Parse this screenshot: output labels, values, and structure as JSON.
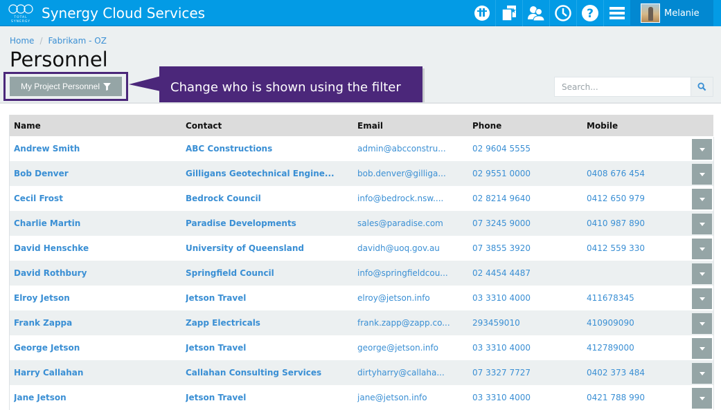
{
  "app": {
    "title": "Synergy Cloud Services",
    "logo_text": "TOTAL SYNERGY",
    "brand_color": "#039be5"
  },
  "nav": {
    "icons": [
      {
        "name": "dashboard-icon",
        "label": "Dashboard"
      },
      {
        "name": "projects-icon",
        "label": "Projects"
      },
      {
        "name": "contacts-icon",
        "label": "Contacts"
      },
      {
        "name": "timesheet-clock-icon",
        "label": "Timesheets"
      },
      {
        "name": "help-icon",
        "label": "Help"
      },
      {
        "name": "menu-icon",
        "label": "Menu"
      }
    ],
    "user": {
      "name": "Melanie"
    }
  },
  "breadcrumb": {
    "items": [
      "Home",
      "Fabrikam - OZ"
    ],
    "separator": "/"
  },
  "page": {
    "title": "Personnel"
  },
  "filter": {
    "label": "My Project Personnel",
    "icon": "filter-icon"
  },
  "callout": {
    "text": "Change who is shown using the filter",
    "color": "#4b277a"
  },
  "search": {
    "placeholder": "Search...",
    "value": ""
  },
  "table": {
    "columns": [
      "Name",
      "Contact",
      "Email",
      "Phone",
      "Mobile"
    ],
    "rows": [
      {
        "name": "Andrew Smith",
        "contact": "ABC Constructions",
        "email": "admin@abcconstru...",
        "phone": "02 9604 5555",
        "mobile": ""
      },
      {
        "name": "Bob Denver",
        "contact": "Gilligans Geotechnical Engine...",
        "email": "bob.denver@gilliga...",
        "phone": "02 9551 0000",
        "mobile": "0408 676 454"
      },
      {
        "name": "Cecil Frost",
        "contact": "Bedrock Council",
        "email": "info@bedrock.nsw....",
        "phone": "02 8214 9640",
        "mobile": "0412 650 979"
      },
      {
        "name": "Charlie Martin",
        "contact": "Paradise Developments",
        "email": "sales@paradise.com",
        "phone": "07 3245 9000",
        "mobile": "0410 987 890"
      },
      {
        "name": "David Henschke",
        "contact": "University of Queensland",
        "email": "davidh@uoq.gov.au",
        "phone": "07 3855 3920",
        "mobile": "0412 559 330"
      },
      {
        "name": "David Rothbury",
        "contact": "Springfield Council",
        "email": "info@springfieldcou...",
        "phone": "02 4454 4487",
        "mobile": ""
      },
      {
        "name": "Elroy Jetson",
        "contact": "Jetson Travel",
        "email": "elroy@jetson.info",
        "phone": "03 3310 4000",
        "mobile": "411678345"
      },
      {
        "name": "Frank Zappa",
        "contact": "Zapp Electricals",
        "email": "frank.zapp@zapp.co...",
        "phone": "293459010",
        "mobile": "410909090"
      },
      {
        "name": "George Jetson",
        "contact": "Jetson Travel",
        "email": "george@jetson.info",
        "phone": "03 3310 4000",
        "mobile": "412789000"
      },
      {
        "name": "Harry Callahan",
        "contact": "Callahan Consulting Services",
        "email": "dirtyharry@callaha...",
        "phone": "07 3327 7727",
        "mobile": "0402 373 484"
      },
      {
        "name": "Jane Jetson",
        "contact": "Jetson Travel",
        "email": "jane@jetson.info",
        "phone": "03 3310 4000",
        "mobile": "0421 788 990"
      }
    ],
    "row_action_icon": "caret-down-icon"
  }
}
